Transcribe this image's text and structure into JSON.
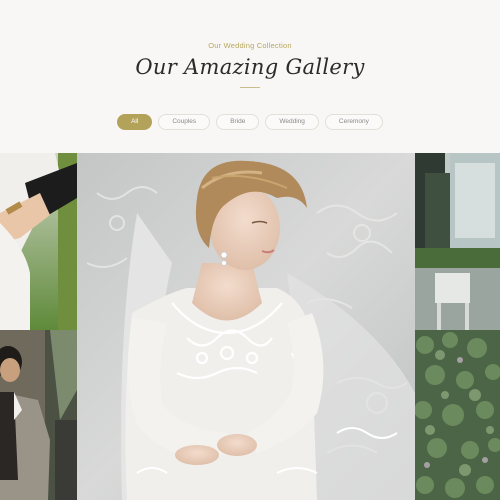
{
  "gallery": {
    "eyebrow": "Our Wedding Collection",
    "title": "Our Amazing Gallery",
    "filters": [
      {
        "label": "All",
        "active": true
      },
      {
        "label": "Couples",
        "active": false
      },
      {
        "label": "Bride",
        "active": false
      },
      {
        "label": "Wedding",
        "active": false
      },
      {
        "label": "Ceremony",
        "active": false
      }
    ]
  },
  "colors": {
    "accent": "#b3a35a",
    "background": "#f8f7f5",
    "title": "#2b2b2b"
  },
  "photos": [
    {
      "name": "couple-hands-photo"
    },
    {
      "name": "groom-photo"
    },
    {
      "name": "bride-portrait-photo"
    },
    {
      "name": "venue-window-photo"
    },
    {
      "name": "greenery-photo"
    }
  ]
}
